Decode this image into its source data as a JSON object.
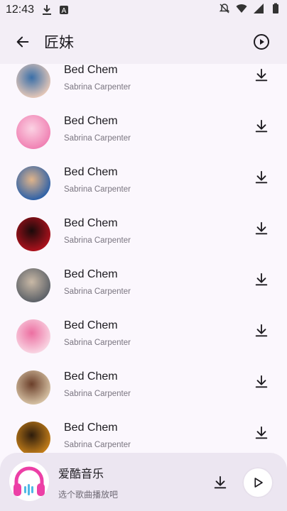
{
  "status_bar": {
    "time": "12:43",
    "icons_left": [
      "download-icon",
      "a-badge-icon"
    ],
    "icons_right": [
      "mute-icon",
      "wifi-icon",
      "signal-icon",
      "battery-icon"
    ]
  },
  "app_bar": {
    "title": "匠妹",
    "back_icon": "arrow-left-icon",
    "play_icon": "play-circle-icon"
  },
  "songs": [
    {
      "title": "Bed Chem",
      "artist": "Sabrina Carpenter",
      "cover_colors": [
        "#e8c9b8",
        "#3a6fa8"
      ]
    },
    {
      "title": "Bed Chem",
      "artist": "Sabrina Carpenter",
      "cover_colors": [
        "#f07fb2",
        "#fbd2e3"
      ]
    },
    {
      "title": "Bed Chem",
      "artist": "Sabrina Carpenter",
      "cover_colors": [
        "#2a5fa8",
        "#e0b48a"
      ]
    },
    {
      "title": "Bed Chem",
      "artist": "Sabrina Carpenter",
      "cover_colors": [
        "#b0121d",
        "#1a0a0a"
      ]
    },
    {
      "title": "Bed Chem",
      "artist": "Sabrina Carpenter",
      "cover_colors": [
        "#5a5f66",
        "#c9b9a6"
      ]
    },
    {
      "title": "Bed Chem",
      "artist": "Sabrina Carpenter",
      "cover_colors": [
        "#f9d7e4",
        "#ec6fa1"
      ]
    },
    {
      "title": "Bed Chem",
      "artist": "Sabrina Carpenter",
      "cover_colors": [
        "#d8c4a6",
        "#6b3f2a"
      ]
    },
    {
      "title": "Bed Chem",
      "artist": "Sabrina Carpenter",
      "cover_colors": [
        "#c8811a",
        "#2d1c0c"
      ]
    }
  ],
  "player": {
    "title": "爱酷音乐",
    "subtitle": "选个歌曲播放吧",
    "accent": "#ec3fa6"
  }
}
